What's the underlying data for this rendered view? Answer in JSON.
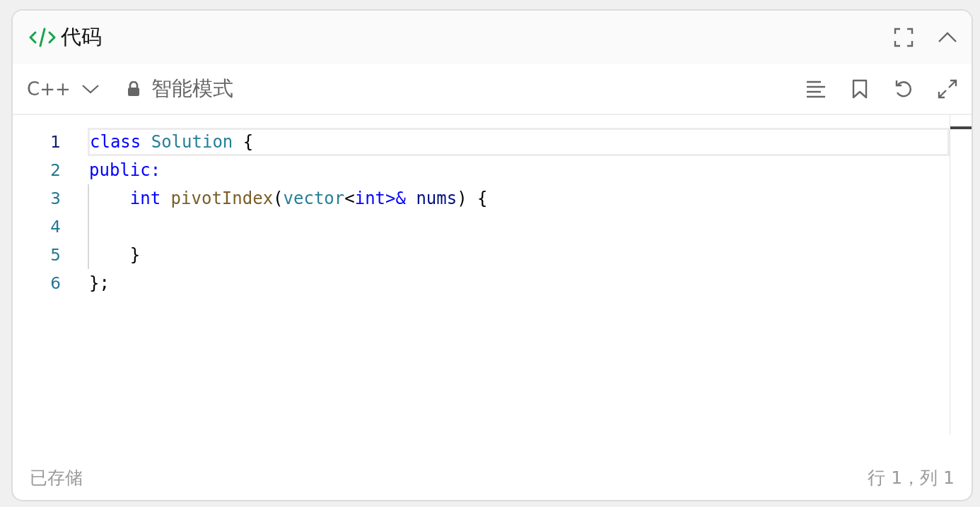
{
  "panel": {
    "title": "代码"
  },
  "toolbar": {
    "language": "C++",
    "mode": "智能模式"
  },
  "editor": {
    "lines": [
      {
        "number": "1",
        "current": true,
        "guide": false,
        "tokens": [
          {
            "text": "class ",
            "kind": "keyword"
          },
          {
            "text": "Solution",
            "kind": "type"
          },
          {
            "text": " {",
            "kind": "plain"
          }
        ]
      },
      {
        "number": "2",
        "current": false,
        "guide": false,
        "tokens": [
          {
            "text": "public:",
            "kind": "keyword"
          }
        ]
      },
      {
        "number": "3",
        "current": false,
        "guide": true,
        "tokens": [
          {
            "text": "    int ",
            "kind": "keyword"
          },
          {
            "text": "pivotIndex",
            "kind": "function"
          },
          {
            "text": "(",
            "kind": "plain"
          },
          {
            "text": "vector",
            "kind": "type"
          },
          {
            "text": "<",
            "kind": "plain"
          },
          {
            "text": "int",
            "kind": "keyword"
          },
          {
            "text": ">& ",
            "kind": "keyword"
          },
          {
            "text": "nums",
            "kind": "variable"
          },
          {
            "text": ") {",
            "kind": "plain"
          }
        ]
      },
      {
        "number": "4",
        "current": false,
        "guide": true
      },
      {
        "number": "5",
        "current": false,
        "guide": true,
        "tokens": [
          {
            "text": "    }",
            "kind": "plain"
          }
        ]
      },
      {
        "number": "6",
        "current": false,
        "guide": false,
        "tokens": [
          {
            "text": "};",
            "kind": "plain"
          }
        ]
      }
    ]
  },
  "status_bar": {
    "saved": "已存储",
    "position": "行 1，列 1"
  }
}
